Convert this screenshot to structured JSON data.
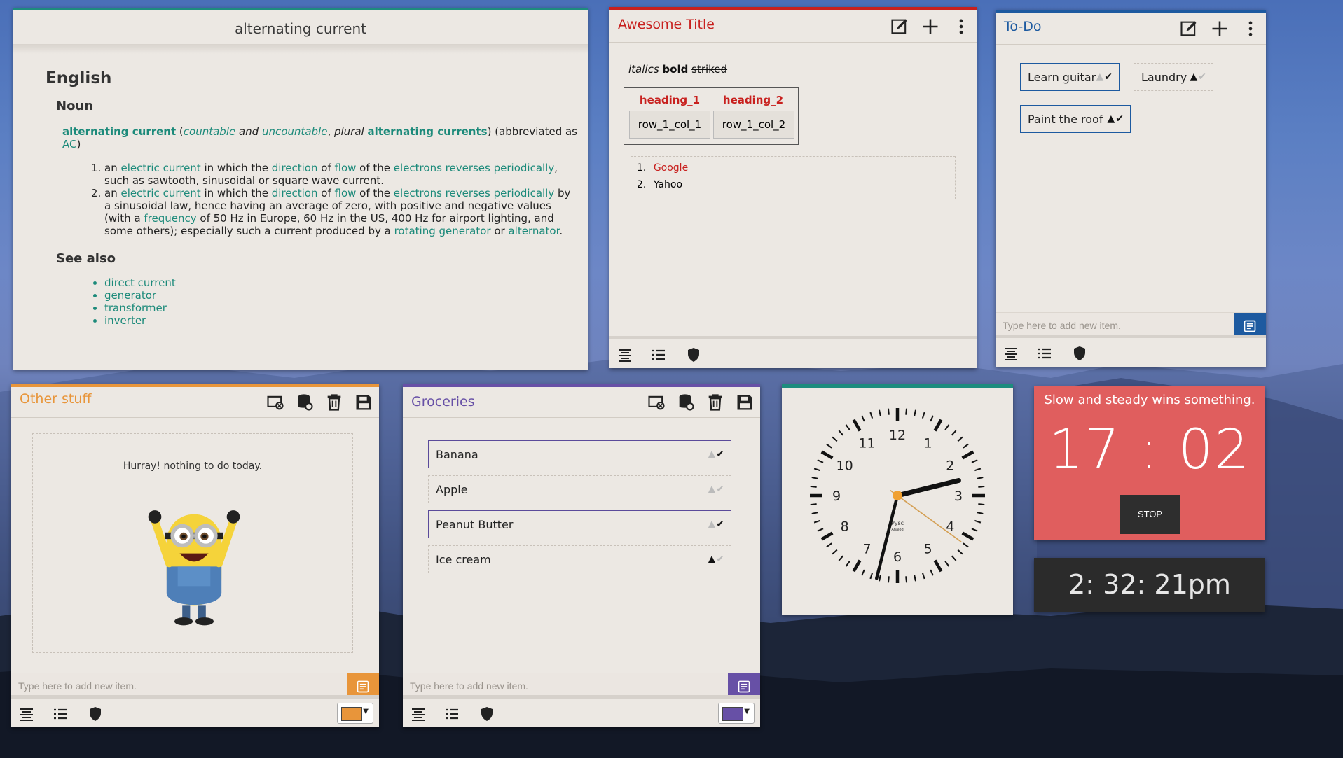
{
  "colors": {
    "teal": "#1d8c7e",
    "red": "#c8201e",
    "blue": "#1d5aa0",
    "orange": "#e8953a",
    "purple": "#6750a6",
    "timer_bg": "#e05e5e",
    "clock_dark": "#2b2b2b"
  },
  "dict": {
    "title": "alternating current",
    "lang": "English",
    "pos": "Noun",
    "head": "alternating current",
    "paren_open": " (",
    "countable": "countable",
    "and": " and ",
    "uncountable": "uncountable",
    "comma": ", ",
    "plural": "plural",
    "space": " ",
    "plural_form": "alternating currents",
    "abbr_pre": ") (abbreviated as ",
    "abbr": "AC",
    "abbr_post": ")",
    "def1": {
      "a": "an ",
      "l1": "electric current",
      "b": " in which the ",
      "l2": "direction",
      "c": " of ",
      "l3": "flow",
      "d": " of the ",
      "l4": "electrons reverses periodically",
      "e": ", such as sawtooth, sinusoidal or square wave current."
    },
    "def2": {
      "a": "an ",
      "l1": "electric current",
      "b": " in which the ",
      "l2": "direction",
      "c": " of ",
      "l3": "flow",
      "d": " of the ",
      "l4": "electrons reverses periodically",
      "e": " by a sinusoidal law, hence having an average of zero, with positive and negative values (with a ",
      "l5": "frequency",
      "f": " of 50 Hz in Europe, 60 Hz in the US, 400 Hz for airport lighting, and some others); especially such a current produced by a ",
      "l6": "rotating generator",
      "g": " or ",
      "l7": "alternator",
      "h": "."
    },
    "see_also": "See also",
    "see_items": [
      "direct current",
      "generator",
      "transformer",
      "inverter"
    ]
  },
  "awesome": {
    "title": "Awesome Title",
    "italics": "italics",
    "bold": "bold",
    "striked": "striked",
    "table": {
      "headers": [
        "heading_1",
        "heading_2"
      ],
      "rows": [
        [
          "row_1_col_1",
          "row_1_col_2"
        ]
      ]
    },
    "list": [
      {
        "n": "1.",
        "t": "Google"
      },
      {
        "n": "2.",
        "t": "Yahoo"
      }
    ]
  },
  "todo": {
    "title": "To-Do",
    "items": [
      {
        "label": "Learn guitar"
      },
      {
        "label": "Laundry"
      },
      {
        "label": "Paint the roof"
      }
    ],
    "placeholder": "Type here to add new item."
  },
  "other": {
    "title": "Other stuff",
    "empty_msg": "Hurray! nothing to do today.",
    "placeholder": "Type here to add new item."
  },
  "groceries": {
    "title": "Groceries",
    "items": [
      {
        "label": "Banana"
      },
      {
        "label": "Apple"
      },
      {
        "label": "Peanut Butter"
      },
      {
        "label": "Ice cream"
      }
    ],
    "placeholder": "Type here to add new item."
  },
  "clock": {
    "numbers": [
      "12",
      "1",
      "2",
      "3",
      "4",
      "5",
      "6",
      "7",
      "8",
      "9",
      "10",
      "11"
    ],
    "brand": "Pysc",
    "sub": "Analog",
    "time": {
      "h": 2,
      "m": 32,
      "s": 21
    }
  },
  "timer": {
    "msg": "Slow and steady wins something.",
    "time": "17 : 02",
    "stop": "STOP"
  },
  "digital": {
    "time": "2: 32: 21pm"
  }
}
